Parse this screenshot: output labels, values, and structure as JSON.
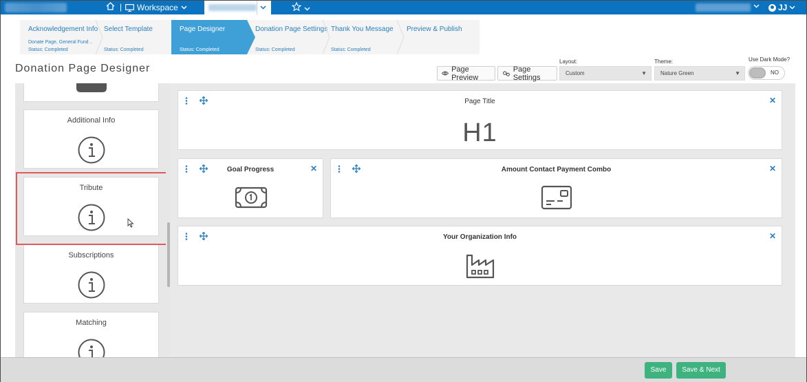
{
  "topbar": {
    "workspace_label": "Workspace",
    "user_initials": "JJ"
  },
  "wizard": {
    "steps": [
      {
        "label": "Acknowledgement Info",
        "detail": "Donate Page, General Fund ..",
        "status": "Status: Completed"
      },
      {
        "label": "Select Template",
        "status": "Status: Completed"
      },
      {
        "label": "Page Designer",
        "status": "Status: Completed"
      },
      {
        "label": "Donation Page Settings",
        "status": "Status: Completed"
      },
      {
        "label": "Thank You Message",
        "status": "Status: Completed"
      },
      {
        "label": "Preview & Publish"
      }
    ],
    "active_step": "Page Designer"
  },
  "header": {
    "title": "Donation Page Designer",
    "preview_label": "Page Preview",
    "settings_label": "Page Settings",
    "layout_label": "Layout:",
    "layout_value": "Custom",
    "theme_label": "Theme:",
    "theme_value": "Nature Green",
    "dark_mode_label": "Use Dark Mode?",
    "dark_mode_value": "NO"
  },
  "components": [
    {
      "title": "Additional Info",
      "icon": "info-icon"
    },
    {
      "title": "Tribute",
      "icon": "info-icon",
      "highlighted": true
    },
    {
      "title": "Subscriptions",
      "icon": "info-icon"
    },
    {
      "title": "Matching",
      "icon": "info-icon"
    }
  ],
  "canvas_blocks": {
    "page_title": {
      "title": "Page Title",
      "content": "H1"
    },
    "goal_progress": {
      "title": "Goal Progress",
      "icon": "money-icon"
    },
    "amount_combo": {
      "title": "Amount Contact Payment Combo",
      "icon": "card-icon"
    },
    "org_info": {
      "title": "Your Organization Info",
      "icon": "factory-icon"
    }
  },
  "footer": {
    "save_label": "Save",
    "save_next_label": "Save & Next"
  },
  "colors": {
    "topbar": "#0b73c0",
    "wizard_active": "#3fa0d8",
    "link_blue": "#2a7fc1",
    "save_green": "#3fb37f",
    "highlight_red": "#e05a5a"
  }
}
